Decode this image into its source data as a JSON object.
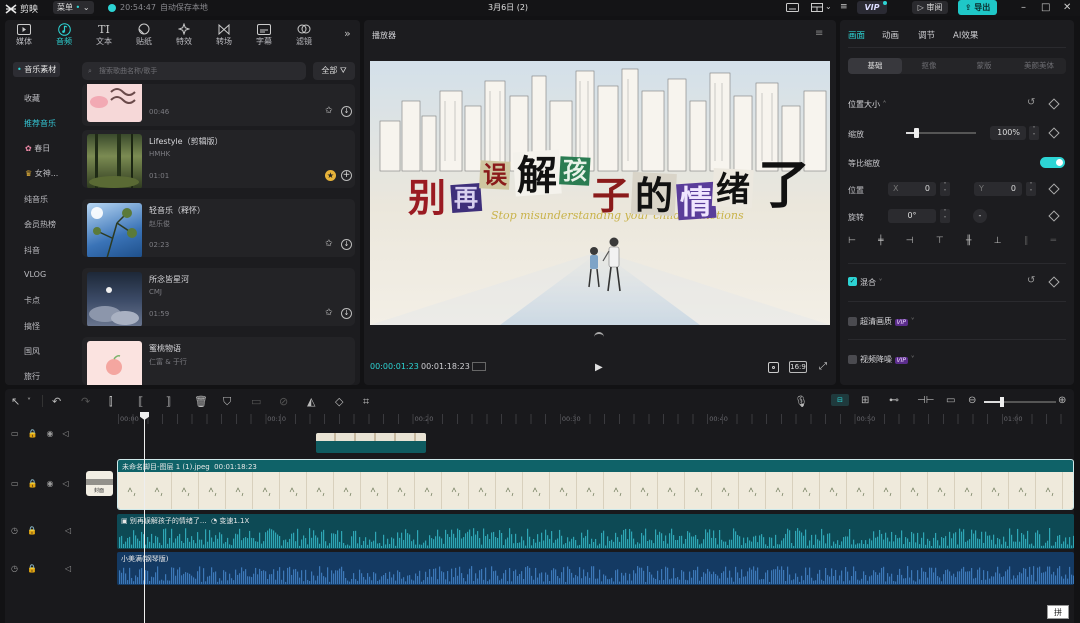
{
  "topbar": {
    "app_name": "剪映",
    "menu_label": "菜单",
    "autosave_time": "20:54:47",
    "autosave_text": "自动保存本地",
    "project_title": "3月6日 (2)",
    "vip_label": "VIP",
    "review_label": "审阅",
    "export_label": "导出"
  },
  "toolbar": {
    "items": [
      {
        "label": "媒体",
        "icon": "media-icon"
      },
      {
        "label": "音频",
        "icon": "audio-icon",
        "active": true
      },
      {
        "label": "文本",
        "icon": "text-icon"
      },
      {
        "label": "贴纸",
        "icon": "sticker-icon"
      },
      {
        "label": "特效",
        "icon": "effects-icon"
      },
      {
        "label": "转场",
        "icon": "transition-icon"
      },
      {
        "label": "字幕",
        "icon": "caption-icon"
      },
      {
        "label": "滤镜",
        "icon": "filter-icon"
      }
    ]
  },
  "categories": {
    "header": "音乐素材",
    "items": [
      "收藏",
      "推荐音乐",
      "春日",
      "女神...",
      "纯音乐",
      "会员热榜",
      "抖音",
      "VLOG",
      "卡点",
      "搞怪",
      "国风",
      "旅行"
    ]
  },
  "search": {
    "placeholder": "搜索歌曲名称/歌手",
    "filter_label": "全部"
  },
  "tracks": [
    {
      "name": "",
      "artist": "",
      "duration": "00:46"
    },
    {
      "name": "Lifestyle（剪辑版）",
      "artist": "HMHK",
      "duration": "01:01"
    },
    {
      "name": "轻音乐（释怀）",
      "artist": "赵乐俊",
      "duration": "02:23"
    },
    {
      "name": "所念皆星河",
      "artist": "CMJ",
      "duration": "01:59"
    },
    {
      "name": "蜜桃物语",
      "artist": "仁富 & 于行",
      "duration": ""
    }
  ],
  "player": {
    "title": "播放器",
    "current_time": "00:00:01:23",
    "total_time": "00:01:18:23",
    "ratio": "16:9",
    "overlay_title_chars": [
      "别",
      "再",
      "误",
      "解",
      "孩",
      "子",
      "的",
      "情",
      "绪",
      "了"
    ],
    "overlay_subtitle": "Stop misunderstanding your child's emotions"
  },
  "inspector": {
    "tabs": [
      "画面",
      "动画",
      "调节",
      "AI效果"
    ],
    "subtabs": [
      "基础",
      "抠像",
      "蒙版",
      "美颜美体"
    ],
    "position_size_label": "位置大小",
    "scale_label": "缩放",
    "scale_value": "100%",
    "scale_level": 0.14,
    "uniform_scale_label": "等比缩放",
    "position_label": "位置",
    "pos_x_label": "X",
    "pos_x_value": "0",
    "pos_y_label": "Y",
    "pos_y_value": "0",
    "rotate_label": "旋转",
    "rotate_value": "0°",
    "blend_label": "混合",
    "hd_label": "超清画质",
    "denoise_label": "视频降噪",
    "vip_tag": "VIP"
  },
  "timeline": {
    "ruler_ticks": [
      "00:00",
      "00:10",
      "00:20",
      "00:30",
      "00:40",
      "00:50",
      "01:00"
    ],
    "video_clip_label": "未命名脚目-图层 1 (1).jpeg",
    "video_clip_duration": "00:01:18:23",
    "cover_label": "封面",
    "text_clip_label": "别再误解孩子的情绪了...",
    "speed_label": "变速1.1X",
    "music_clip_label": "小美满(钢琴版)",
    "ime_label": "拼"
  },
  "colors": {
    "accent": "#2dd4d4",
    "export": "#1fc7c7",
    "video_track": "#0f6268",
    "text_track": "#0e4a58",
    "music_track": "#153a66"
  }
}
